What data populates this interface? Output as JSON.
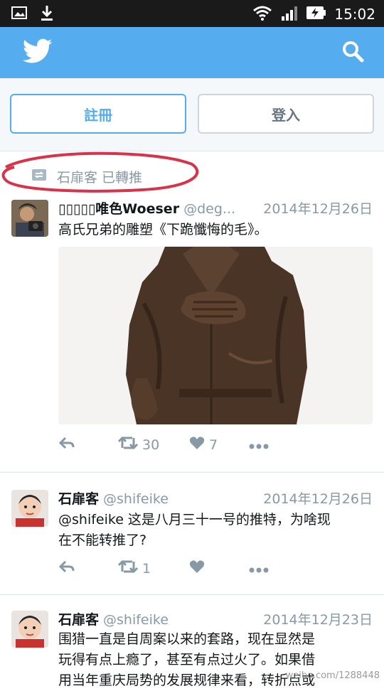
{
  "status_bar": {
    "time": "15:02",
    "icons": [
      "gallery-icon",
      "download-icon",
      "wifi-icon",
      "signal-icon",
      "battery-charging-icon"
    ]
  },
  "header": {
    "logo": "twitter-bird-icon",
    "search_icon": "search-icon",
    "brand_color": "#55acee"
  },
  "auth": {
    "signup_label": "註冊",
    "login_label": "登入"
  },
  "tweets": [
    {
      "retweet_context": "石扉客 已轉推",
      "author_name": "▯▯▯▯▯唯色Woeser",
      "handle": "@deg...",
      "date": "2014年12月26日",
      "text": "高氏兄弟的雕塑《下跪懺悔的毛》。",
      "has_photo": true,
      "retweets": "30",
      "likes": "7"
    },
    {
      "author_name": "石扉客",
      "handle": "@shifeike",
      "date": "2014年12月26日",
      "text_line1": "@shifeike 这是八月三十一号的推特，为啥现",
      "text_line2": "在不能转推了?",
      "retweets": "1",
      "likes": ""
    },
    {
      "author_name": "石扉客",
      "handle": "@shifeike",
      "date": "2014年12月23日",
      "text_line1": "围猎一直是自周案以来的套路，现在显然是",
      "text_line2": "玩得有点上瘾了，甚至有点过火了。如果借",
      "text_line3": "用当年重庆局势的发展规律来看，转折点或"
    }
  ],
  "watermark": "weibo.com/1288448",
  "colors": {
    "accent": "#55acee",
    "muted_text": "#8899a6",
    "highlight_ring": "#d8334a"
  }
}
